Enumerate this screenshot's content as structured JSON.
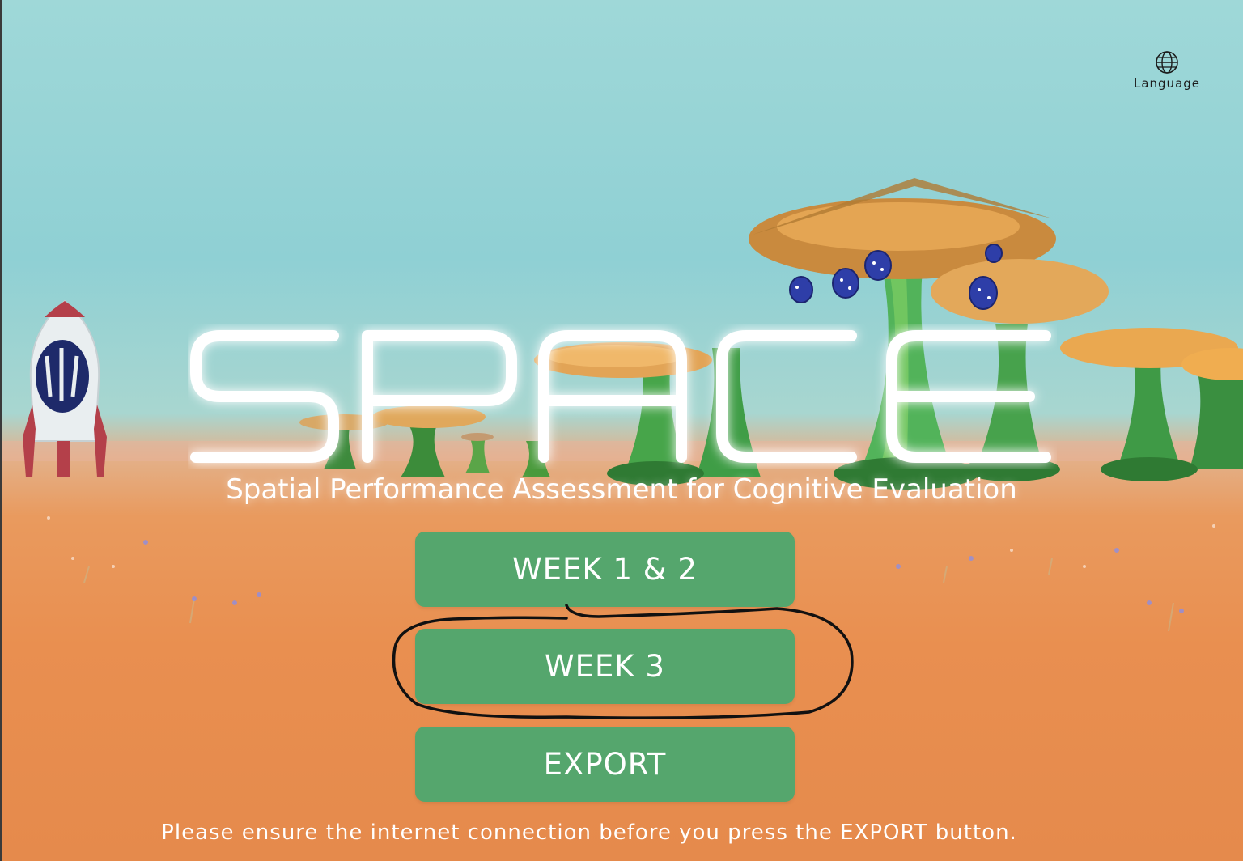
{
  "top_right": {
    "icon": "globe-icon",
    "language_label": "Language"
  },
  "title": {
    "logo_text": "SPACE",
    "subtitle": "Spatial Performance Assessment for Cognitive Evaluation"
  },
  "menu": {
    "week12_label": "WEEK 1 & 2",
    "week3_label": "WEEK 3",
    "export_label": "EXPORT"
  },
  "footer": {
    "notice": "Please ensure the internet connection before you press the EXPORT button."
  },
  "colors": {
    "button_green": "#55a66d",
    "sky": "#9fd8d8",
    "ground": "#e98f50",
    "annotation_ink": "#111111"
  }
}
